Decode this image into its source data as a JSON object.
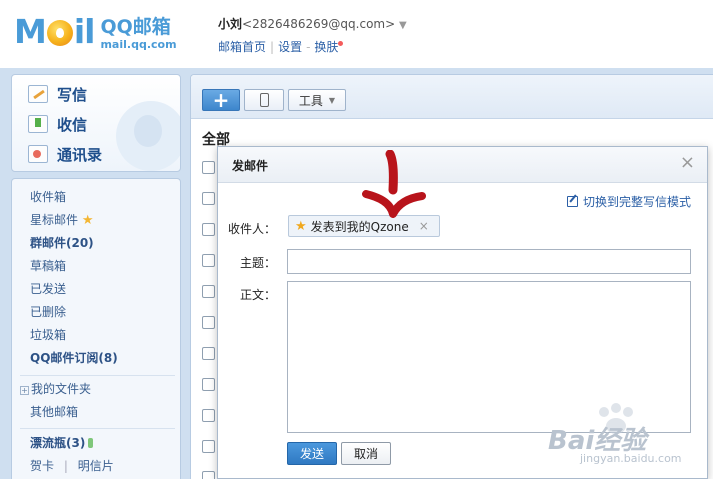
{
  "header": {
    "logo_text": "Mail",
    "logo_cn": "QQ邮箱",
    "logo_domain": "mail.qq.com",
    "user_name": "小刘",
    "user_email": "<2826486269@qq.com>",
    "link_home": "邮箱首页",
    "link_settings": "设置",
    "link_skin": "换肤",
    "sep_1": "|",
    "sep_2": "-"
  },
  "left": {
    "actions": [
      {
        "label": "写信",
        "icon": "write-icon"
      },
      {
        "label": "收信",
        "icon": "inbox-download-icon"
      },
      {
        "label": "通讯录",
        "icon": "contacts-icon"
      }
    ],
    "folders": {
      "inbox": "收件箱",
      "starred": "星标邮件",
      "group": "群邮件(20)",
      "drafts": "草稿箱",
      "sent": "已发送",
      "deleted": "已删除",
      "trash": "垃圾箱",
      "subscriptions": "QQ邮件订阅(8)",
      "my_folders": "我的文件夹",
      "other_mail": "其他邮箱",
      "drift_bottle": "漂流瓶(3)",
      "greeting_card": "贺卡",
      "postcard": "明信片",
      "card_sep": "|"
    },
    "expand_symbol": "+",
    "star_symbol": "★"
  },
  "main": {
    "toolbar": {
      "compose_symbol": "+",
      "tools_label": "工具",
      "tools_caret": "▼"
    },
    "section_title": "全部"
  },
  "dialog": {
    "title": "发邮件",
    "close_symbol": "×",
    "switch_mode_label": "切换到完整写信模式",
    "recipient_label": "收件人：",
    "recipient_value": "发表到我的Qzone",
    "recipient_remove": "×",
    "subject_label": "主题：",
    "subject_value": "",
    "body_label": "正文：",
    "body_value": "",
    "send_label": "发送",
    "cancel_label": "取消"
  },
  "watermark": {
    "text": "Bai经验",
    "url": "jingyan.baidu.com"
  },
  "colors": {
    "accent": "#4a9bd7",
    "link": "#2b5fa6",
    "frame_bg": "#cfdff0",
    "send_button": "#3a86cf",
    "annotation_arrow": "#b8141b"
  }
}
